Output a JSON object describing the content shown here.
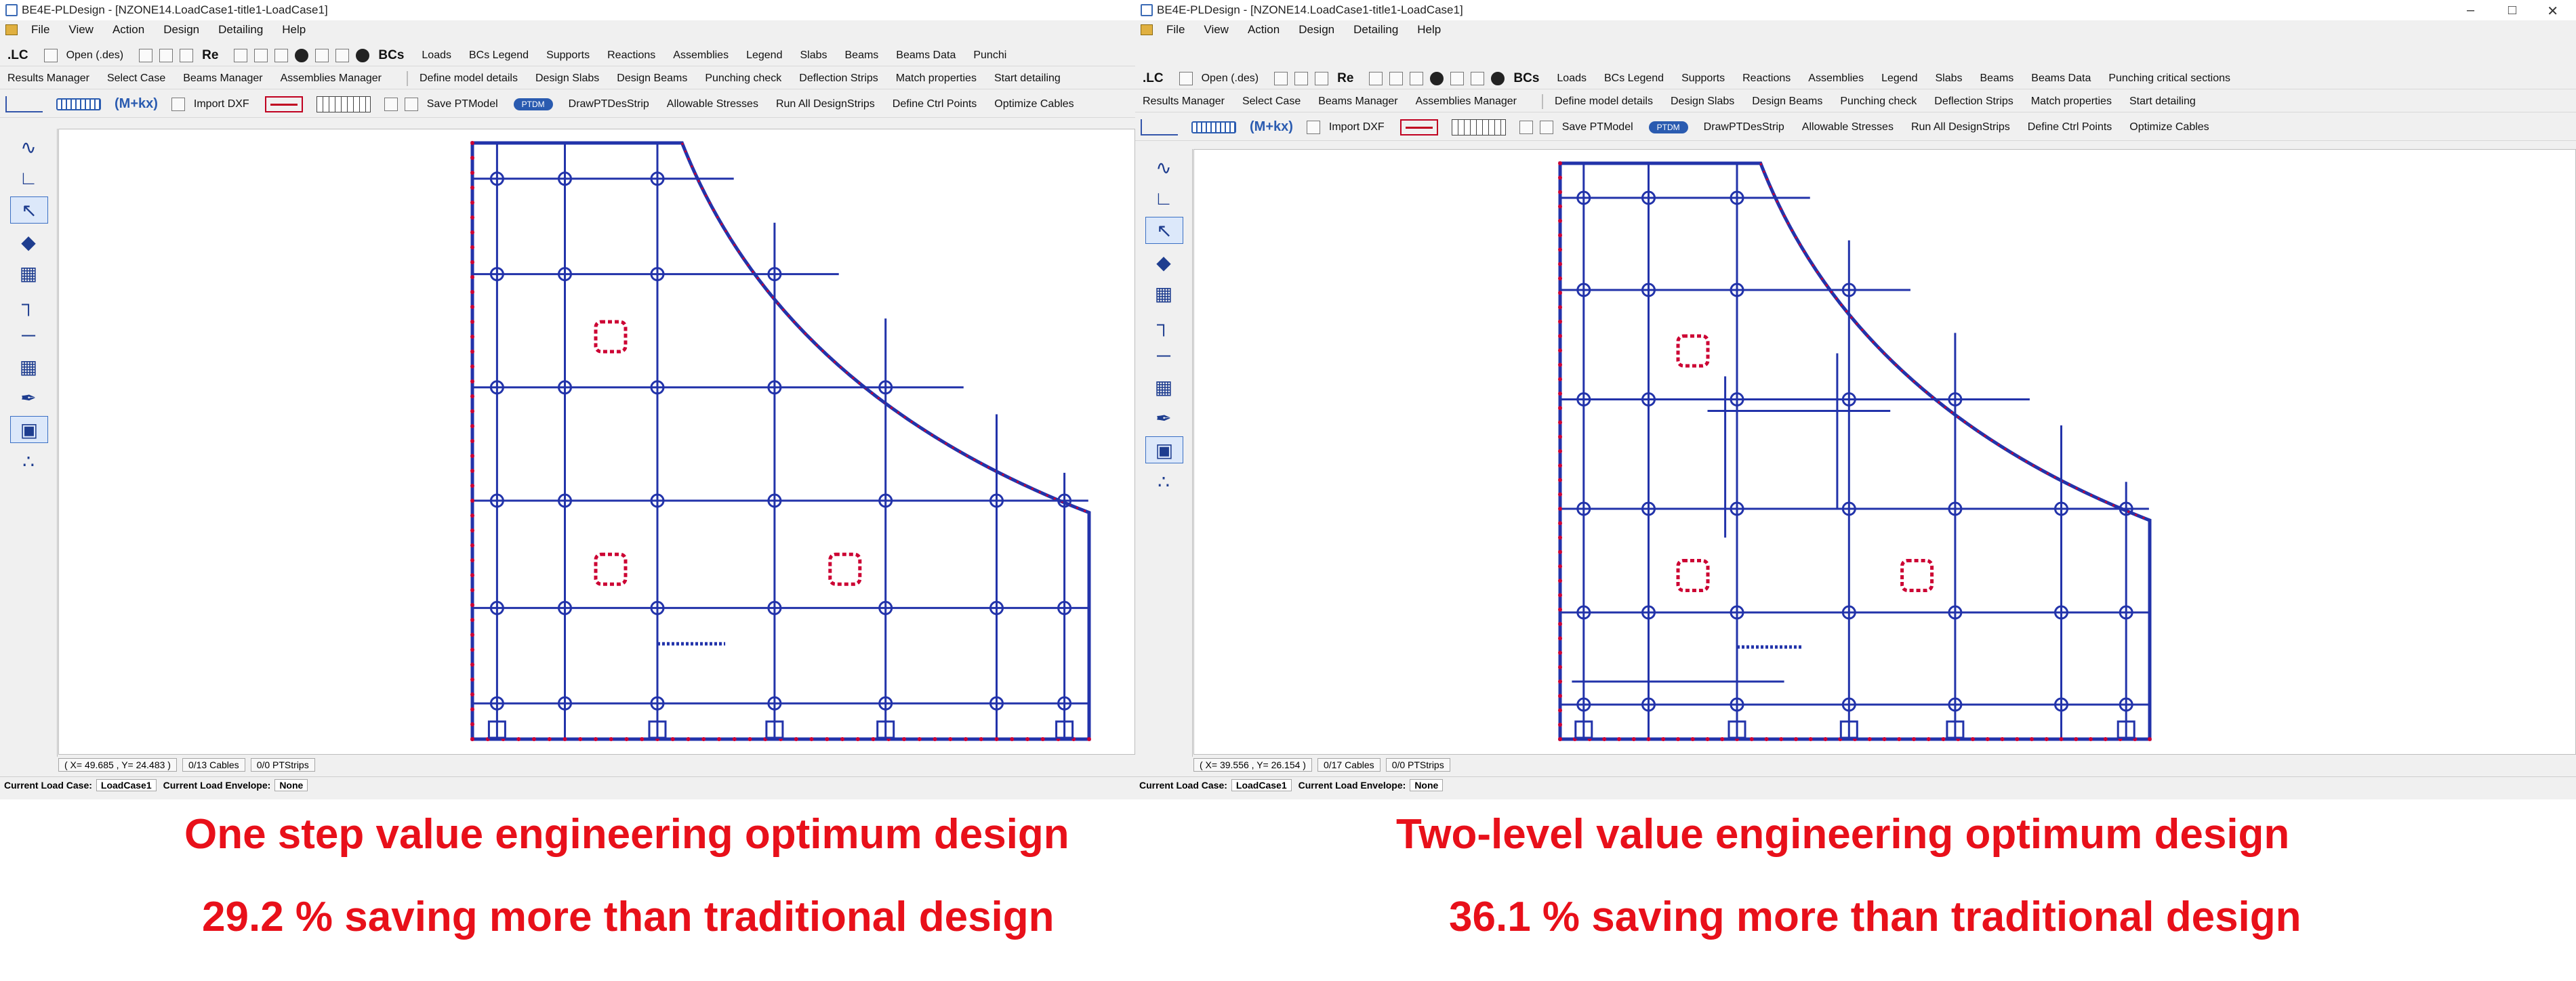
{
  "left_window": {
    "title": "BE4E-PLDesign - [NZONE14.LoadCase1-title1-LoadCase1]",
    "menu": [
      "File",
      "View",
      "Action",
      "Design",
      "Detailing",
      "Help"
    ],
    "toolbar1": {
      "lc": ".LC",
      "open": "Open (.des)",
      "re": "Re",
      "bcs": "BCs",
      "items": [
        "Loads",
        "BCs Legend",
        "Supports",
        "Reactions",
        "Assemblies",
        "Legend",
        "Slabs",
        "Beams",
        "Beams Data",
        "Punchi"
      ]
    },
    "toolbar2": [
      "Results Manager",
      "Select Case",
      "Beams Manager",
      "Assemblies Manager",
      "Define model details",
      "Design Slabs",
      "Design Beams",
      "Punching check",
      "Deflection Strips",
      "Match properties",
      "Start detailing"
    ],
    "toolbar3": {
      "formula": "(M+kx)",
      "import_dxf": "Import DXF",
      "save_pt": "Save PTModel",
      "ptdm": "PTDM",
      "items": [
        "DrawPTDesStrip",
        "Allowable Stresses",
        "Run All DesignStrips",
        "Define Ctrl Points",
        "Optimize Cables"
      ]
    },
    "status": {
      "coords": "( X= 49.685 , Y= 24.483 )",
      "cables": "0/13 Cables",
      "ptstrips": "0/0 PTStrips"
    },
    "load": {
      "case_label": "Current Load Case:",
      "case_value": "LoadCase1",
      "env_label": "Current Load Envelope:",
      "env_value": "None"
    }
  },
  "right_window": {
    "title": "BE4E-PLDesign - [NZONE14.LoadCase1-title1-LoadCase1]",
    "menu": [
      "File",
      "View",
      "Action",
      "Design",
      "Detailing",
      "Help"
    ],
    "toolbar1": {
      "lc": ".LC",
      "open": "Open (.des)",
      "re": "Re",
      "bcs": "BCs",
      "items": [
        "Loads",
        "BCs Legend",
        "Supports",
        "Reactions",
        "Assemblies",
        "Legend",
        "Slabs",
        "Beams",
        "Beams Data",
        "Punching critical sections"
      ]
    },
    "toolbar2": [
      "Results Manager",
      "Select Case",
      "Beams Manager",
      "Assemblies Manager",
      "Define model details",
      "Design Slabs",
      "Design Beams",
      "Punching check",
      "Deflection Strips",
      "Match properties",
      "Start detailing"
    ],
    "toolbar3": {
      "formula": "(M+kx)",
      "import_dxf": "Import DXF",
      "save_pt": "Save PTModel",
      "ptdm": "PTDM",
      "items": [
        "DrawPTDesStrip",
        "Allowable Stresses",
        "Run All DesignStrips",
        "Define Ctrl Points",
        "Optimize Cables"
      ]
    },
    "status": {
      "coords": "( X= 39.556 , Y= 26.154 )",
      "cables": "0/17 Cables",
      "ptstrips": "0/0 PTStrips"
    },
    "load": {
      "case_label": "Current Load Case:",
      "case_value": "LoadCase1",
      "env_label": "Current Load Envelope:",
      "env_value": "None"
    }
  },
  "captions": {
    "left_line1": "One step value engineering optimum design",
    "left_line2": "29.2 % saving more than traditional design",
    "right_line1": "Two-level value engineering optimum design",
    "right_line2": "36.1 % saving more than traditional design"
  },
  "colors": {
    "structure": "#2233aa",
    "nodes": "#cc0033",
    "caption": "#e8101a"
  },
  "icons": {
    "window_controls": [
      "minimize-icon",
      "maximize-icon",
      "close-icon"
    ]
  }
}
